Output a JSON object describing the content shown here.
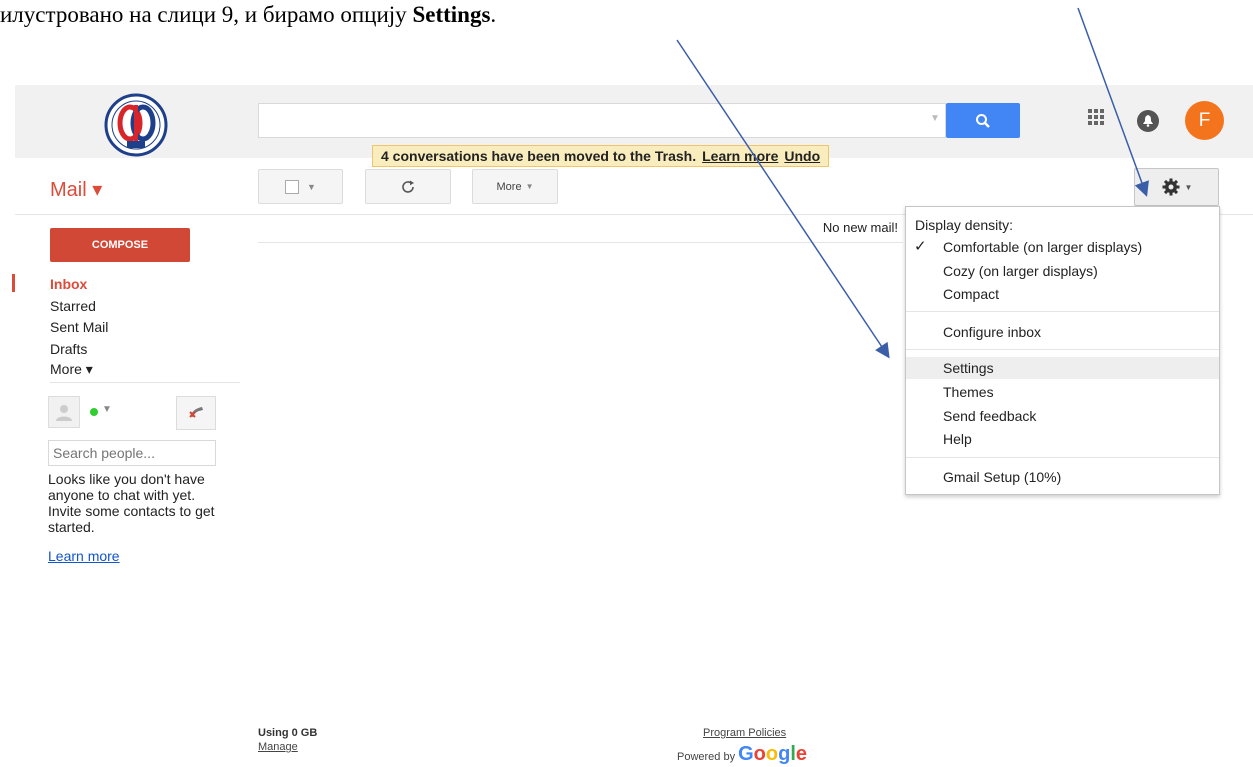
{
  "caption": {
    "text": "илустровано на слици 9, и бирамо опцију ",
    "bold": "Settings",
    "end": "."
  },
  "colors": {
    "accent": "#dd4b39",
    "search_blue": "#4285f4",
    "avatar": "#f4741d",
    "arrow": "#3a5ea8"
  },
  "header": {
    "avatar_letter": "F",
    "apps_icon": "apps-grid-icon",
    "notification_icon": "bell-icon"
  },
  "notice": {
    "text": "4 conversations have been moved to the Trash.",
    "learn_more": "Learn more",
    "undo": "Undo"
  },
  "mail_menu": {
    "label": "Mail ▾"
  },
  "toolbar": {
    "more_label": "More",
    "refresh_icon": "refresh-icon"
  },
  "main": {
    "empty_message": "No new mail!"
  },
  "sidebar": {
    "compose": "COMPOSE",
    "items": [
      {
        "label": "Inbox"
      },
      {
        "label": "Starred"
      },
      {
        "label": "Sent Mail"
      },
      {
        "label": "Drafts"
      },
      {
        "label": "More ▾"
      }
    ]
  },
  "chat": {
    "search_placeholder": "Search people...",
    "empty_text": "Looks like you don't have anyone to chat with yet. Invite some contacts to get started.",
    "learn_more": "Learn more"
  },
  "settings_menu": {
    "density_header": "Display density:",
    "density_options": [
      {
        "label": "Comfortable (on larger displays)",
        "checked": true
      },
      {
        "label": "Cozy (on larger displays)",
        "checked": false
      },
      {
        "label": "Compact",
        "checked": false
      }
    ],
    "configure": "Configure inbox",
    "items": [
      {
        "label": "Settings"
      },
      {
        "label": "Themes"
      },
      {
        "label": "Send feedback"
      },
      {
        "label": "Help"
      }
    ],
    "setup": "Gmail Setup (10%)"
  },
  "footer": {
    "usage": "Using 0 GB",
    "manage": "Manage",
    "policies": "Program Policies",
    "powered_by": "Powered by",
    "google": "Google"
  }
}
